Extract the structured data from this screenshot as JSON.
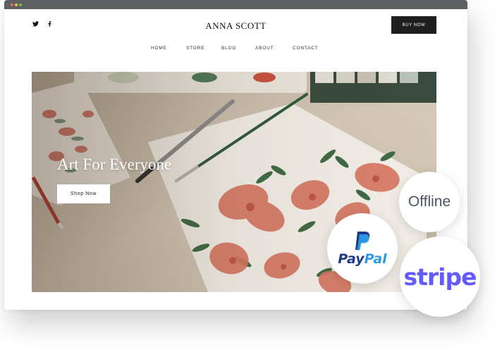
{
  "site": {
    "brand": "ANNA SCOTT",
    "buy_label": "BUY NOW",
    "social": [
      "twitter-icon",
      "facebook-icon"
    ]
  },
  "nav": {
    "items": [
      "HOME",
      "STORE",
      "BLOG",
      "ABOUT",
      "CONTACT"
    ]
  },
  "hero": {
    "title": "Art For Everyone",
    "button_label": "Shop Now"
  },
  "payment_badges": {
    "offline": "Offline",
    "paypal_pay": "Pay",
    "paypal_pal": "Pal",
    "stripe": "stripe"
  },
  "colors": {
    "buy_button": "#1f1f1f",
    "paypal_dark": "#1b3a8a",
    "paypal_light": "#2d9be0",
    "stripe": "#635bff",
    "offline_text": "#4b5563"
  }
}
